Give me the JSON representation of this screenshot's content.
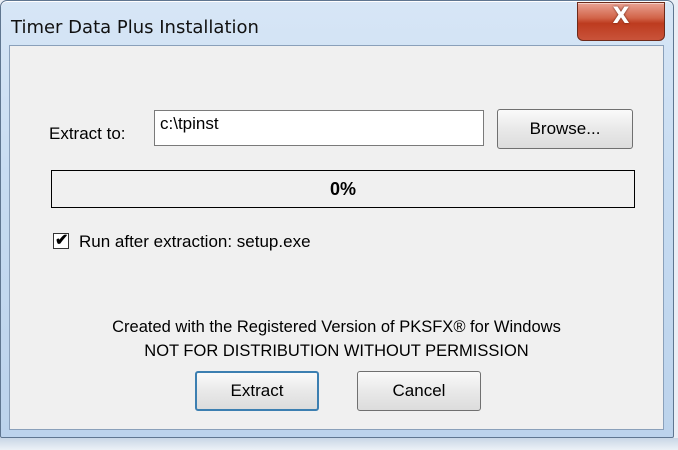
{
  "window": {
    "title": "Timer Data Plus Installation",
    "close_symbol": "X"
  },
  "extract": {
    "label": "Extract to:",
    "path_value": "c:\\tpinst",
    "browse_label": "Browse..."
  },
  "progress": {
    "percent": 0,
    "text": "0%"
  },
  "run_after": {
    "checked": true,
    "label": "Run after extraction: setup.exe"
  },
  "credits": {
    "line1": "Created with the Registered Version of PKSFX® for Windows",
    "line2": "NOT FOR DISTRIBUTION WITHOUT PERMISSION"
  },
  "buttons": {
    "extract_label": "Extract",
    "cancel_label": "Cancel"
  },
  "colors": {
    "close_button": "#c9533a",
    "progress_fill": "#0a246a"
  },
  "icons": {
    "checkmark": "checkmark-icon",
    "close": "close-icon"
  }
}
